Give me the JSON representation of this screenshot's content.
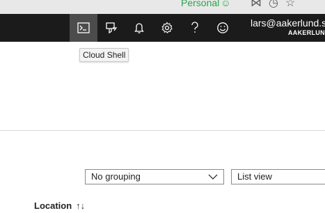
{
  "browser": {
    "profile_label": "Personal",
    "profile_icon": "person-icon",
    "icons": [
      "extensions-icon",
      "history-icon",
      "bookmark-star-icon"
    ]
  },
  "topbar": {
    "buttons": [
      {
        "name": "cloud-shell",
        "icon": "terminal-icon",
        "active": true
      },
      {
        "name": "directory-filter",
        "icon": "filter-icon"
      },
      {
        "name": "notifications",
        "icon": "bell-icon"
      },
      {
        "name": "settings",
        "icon": "gear-icon"
      },
      {
        "name": "help",
        "icon": "question-icon"
      },
      {
        "name": "feedback",
        "icon": "smiley-icon"
      }
    ],
    "user_email": "lars@aakerlund.se",
    "user_tenant": "AAKERLUND"
  },
  "tooltip": {
    "text": "Cloud Shell"
  },
  "controls": {
    "grouping_value": "No grouping",
    "view_value": "List view"
  },
  "table": {
    "column_location": "Location",
    "sort_icon": "sort-arrows-icon"
  }
}
